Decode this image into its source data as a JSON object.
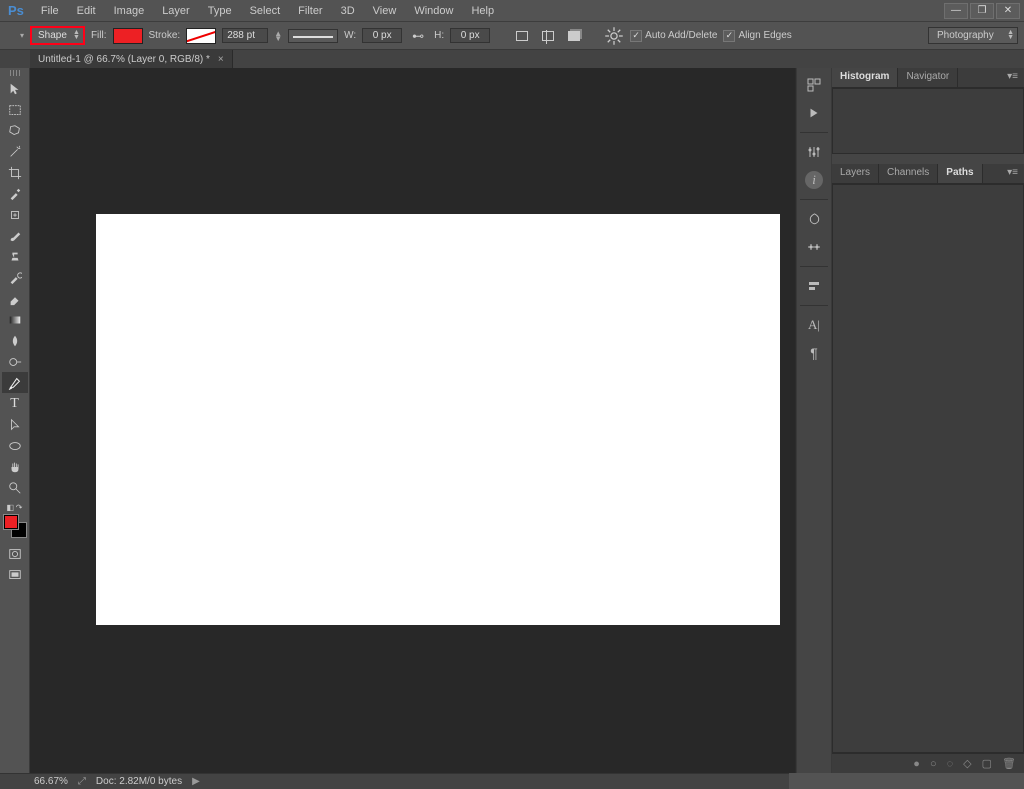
{
  "app": {
    "logo": "Ps"
  },
  "menu": [
    "File",
    "Edit",
    "Image",
    "Layer",
    "Type",
    "Select",
    "Filter",
    "3D",
    "View",
    "Window",
    "Help"
  ],
  "options": {
    "mode": "Shape",
    "fill_label": "Fill:",
    "stroke_label": "Stroke:",
    "stroke_weight": "288 pt",
    "w_label": "W:",
    "w_value": "0 px",
    "h_label": "H:",
    "h_value": "0 px",
    "auto_add_delete": "Auto Add/Delete",
    "align_edges": "Align Edges",
    "workspace": "Photography"
  },
  "doc_tab": "Untitled-1 @ 66.7% (Layer 0, RGB/8) *",
  "tools": [
    "move",
    "rect-marquee",
    "lasso",
    "magic-wand",
    "crop",
    "eyedropper",
    "spot-heal",
    "brush",
    "clone-stamp",
    "history-brush",
    "eraser",
    "gradient",
    "blur",
    "dodge",
    "pen",
    "type",
    "path-select",
    "ellipse-shape",
    "hand",
    "zoom"
  ],
  "right_strip": [
    "history-icon",
    "play-icon",
    "",
    "adjustments-icon",
    "info-icon",
    "",
    "styles-icon",
    "swatches-icon",
    "",
    "align-icon",
    "",
    "char-A-icon",
    "paragraph-icon"
  ],
  "panels": {
    "top": {
      "tabs": [
        "Histogram",
        "Navigator"
      ],
      "active": "Histogram"
    },
    "bottom": {
      "tabs": [
        "Layers",
        "Channels",
        "Paths"
      ],
      "active": "Paths"
    }
  },
  "status": {
    "zoom": "66.67%",
    "doc_info": "Doc: 2.82M/0 bytes"
  }
}
